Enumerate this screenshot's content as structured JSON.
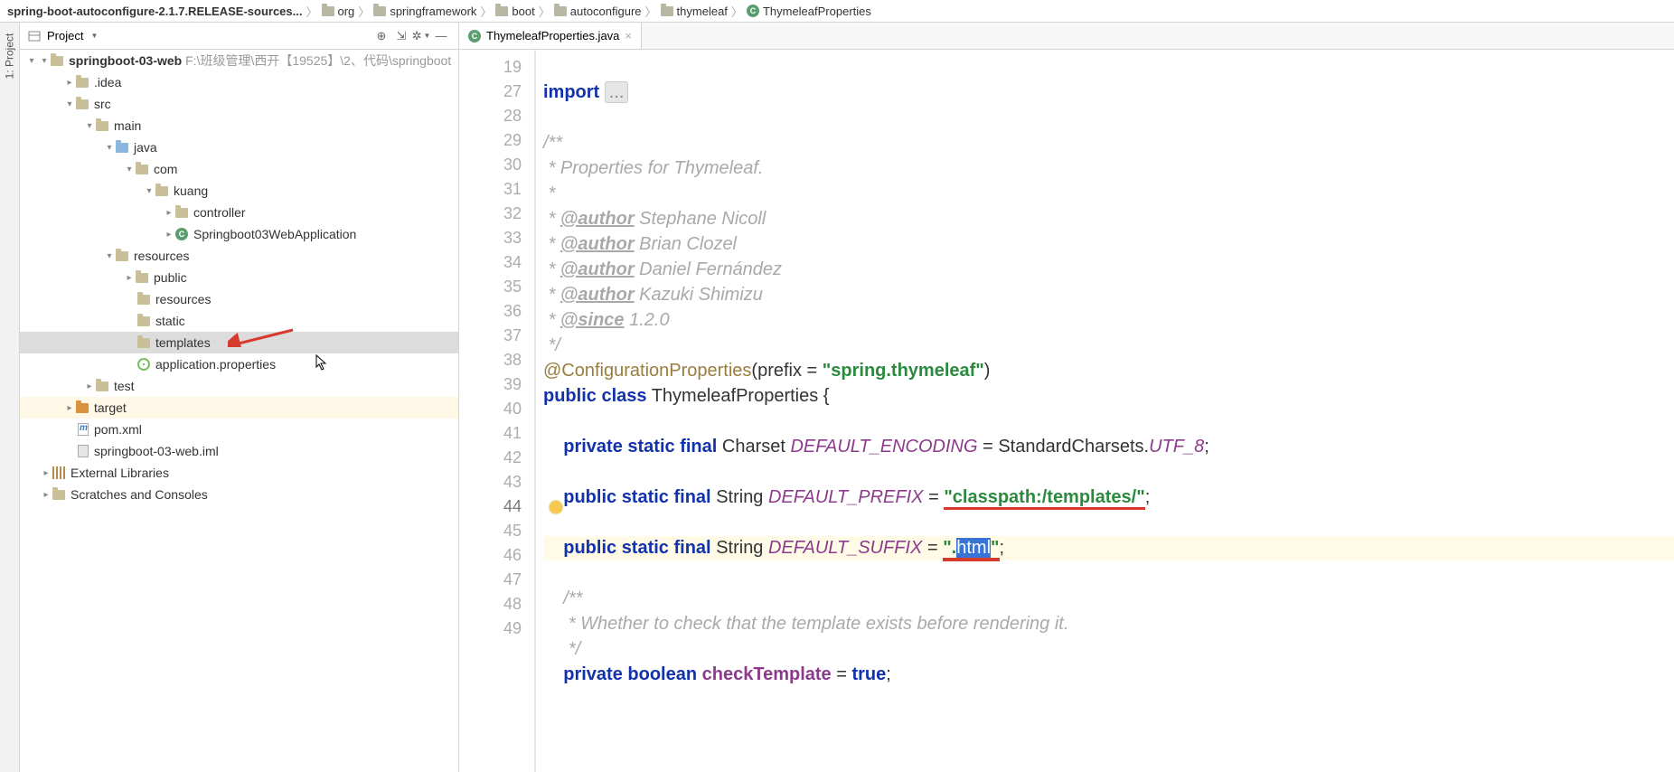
{
  "breadcrumbs": [
    "spring-boot-autoconfigure-2.1.7.RELEASE-sources...",
    "org",
    "springframework",
    "boot",
    "autoconfigure",
    "thymeleaf",
    "ThymeleafProperties"
  ],
  "project_panel": {
    "title": "Project",
    "side_label": "1: Project"
  },
  "toolbar_icons": {
    "target": "⊕",
    "collapse": "⇲",
    "gear": "✲",
    "hide": "—"
  },
  "tab": {
    "label": "ThymeleafProperties.java",
    "close": "×"
  },
  "tree": {
    "root": "springboot-03-web",
    "root_path": "F:\\班级管理\\西开【19525】\\2、代码\\springboot",
    "idea": ".idea",
    "src": "src",
    "main": "main",
    "java": "java",
    "com": "com",
    "kuang": "kuang",
    "controller": "controller",
    "app_class": "Springboot03WebApplication",
    "resources": "resources",
    "public": "public",
    "res_inner": "resources",
    "static": "static",
    "templates": "templates",
    "app_prop": "application.properties",
    "test": "test",
    "target": "target",
    "pom": "pom.xml",
    "iml": "springboot-03-web.iml",
    "ext_lib": "External Libraries",
    "scratches": "Scratches and Consoles"
  },
  "gutter_lines": [
    "19",
    "27",
    "28",
    "29",
    "30",
    "31",
    "32",
    "33",
    "34",
    "35",
    "36",
    "37",
    "38",
    "39",
    "40",
    "41",
    "42",
    "43",
    "44",
    "45",
    "46",
    "47",
    "48",
    "49"
  ],
  "code": {
    "import_kw": "import",
    "import_dots": "...",
    "c_open": "/**",
    "c_desc": " * Properties for Thymeleaf.",
    "c_blank": " *",
    "auth_tag": "@author",
    "a1": " Stephane Nicoll",
    "a2": " Brian Clozel",
    "a3": " Daniel Fernández",
    "a4": " Kazuki Shimizu",
    "since_tag": "@since",
    "since_v": " 1.2.0",
    "c_close": " */",
    "anno": "@ConfigurationProperties",
    "anno_args": "(prefix = ",
    "anno_str": "\"spring.thymeleaf\"",
    "anno_close": ")",
    "pub": "public",
    "cls": "class",
    "stat": "static",
    "fin": "final",
    "priv": "private",
    "boolkw": "boolean",
    "classname": "ThymeleafProperties",
    "brace": " {",
    "charset": "Charset",
    "enc": "DEFAULT_ENCODING",
    "enc_rhs": " = StandardCharsets.",
    "utf": "UTF_8",
    "string": "String",
    "prefix": "DEFAULT_PREFIX",
    "prefix_val": "\"classpath:/templates/\"",
    "suffix": "DEFAULT_SUFFIX",
    "suffix_q": "\".",
    "suffix_sel": "html",
    "suffix_end": "\"",
    "c2_open": "/**",
    "c2_body": " * Whether to check that the template exists before rendering it.",
    "c2_close": " */",
    "checkt": "checkTemplate",
    "true": "true"
  }
}
